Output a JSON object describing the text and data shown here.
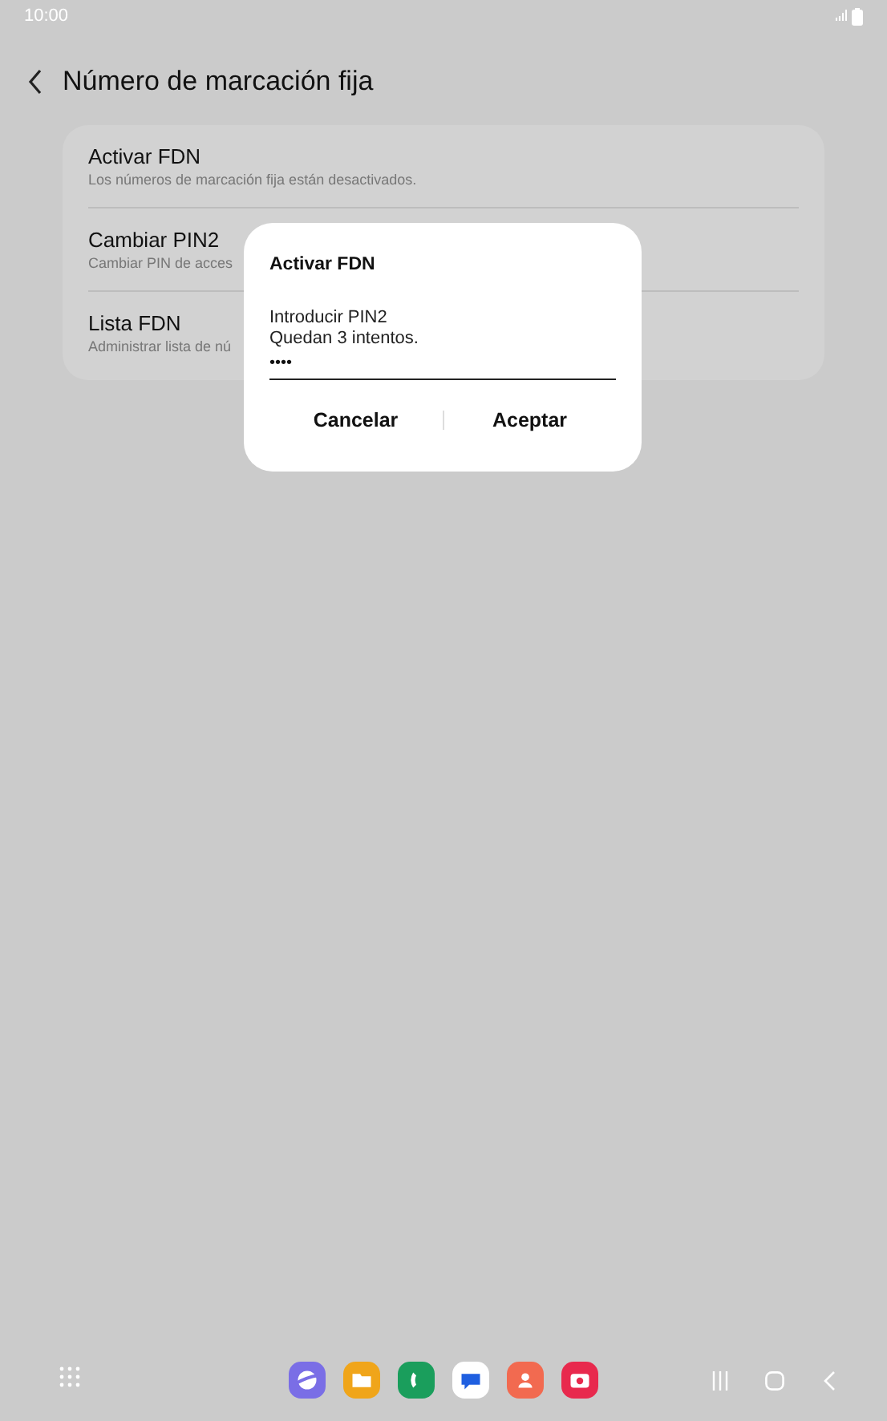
{
  "status_bar": {
    "time": "10:00"
  },
  "header": {
    "title": "Número de marcación fija"
  },
  "settings": [
    {
      "title": "Activar FDN",
      "subtitle": "Los números de marcación fija están desactivados."
    },
    {
      "title": "Cambiar PIN2",
      "subtitle": "Cambiar PIN de acces"
    },
    {
      "title": "Lista FDN",
      "subtitle": "Administrar lista de nú"
    }
  ],
  "dialog": {
    "title": "Activar FDN",
    "message": "Introducir PIN2",
    "hint": "Quedan 3 intentos.",
    "value": "••••",
    "buttons": [
      "Cancelar",
      "Aceptar"
    ]
  },
  "dock": [
    {
      "color": "#7a6ee6"
    },
    {
      "color": "#f0a51a"
    },
    {
      "color": "#1a9e5c"
    },
    {
      "color": "#ffffff"
    },
    {
      "color": "#f26a50"
    },
    {
      "color": "#e8294d"
    }
  ]
}
